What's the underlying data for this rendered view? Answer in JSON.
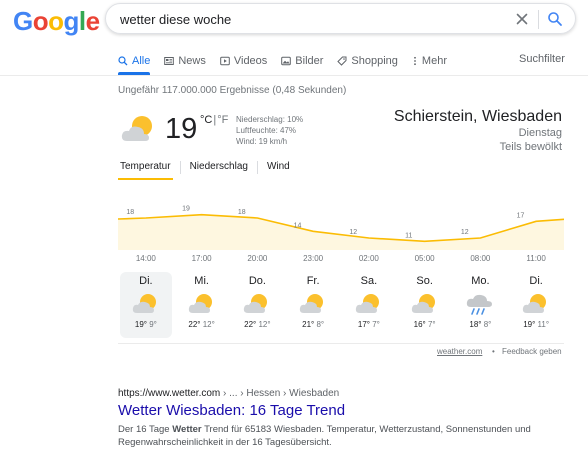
{
  "logo": {
    "letters": [
      "G",
      "o",
      "o",
      "g",
      "l",
      "e"
    ],
    "colors": [
      "#4285f4",
      "#ea4335",
      "#fbbc05",
      "#4285f4",
      "#34a853",
      "#ea4335"
    ]
  },
  "search": {
    "query": "wetter diese woche"
  },
  "tabs": [
    {
      "label": "Alle",
      "icon": "search-icon",
      "active": true
    },
    {
      "label": "News",
      "icon": "news-icon",
      "active": false
    },
    {
      "label": "Videos",
      "icon": "video-icon",
      "active": false
    },
    {
      "label": "Bilder",
      "icon": "image-icon",
      "active": false
    },
    {
      "label": "Shopping",
      "icon": "tag-icon",
      "active": false
    },
    {
      "label": "Mehr",
      "icon": "more-icon",
      "active": false
    }
  ],
  "suchfilter": "Suchfilter",
  "result_stats": "Ungefähr 117.000.000 Ergebnisse (0,48 Sekunden)",
  "weather": {
    "temperature": "19",
    "unit_c": "°C",
    "unit_sep": "|",
    "unit_f": "°F",
    "precipitation": "Niederschlag: 10%",
    "humidity": "Luftfeuchte: 47%",
    "wind": "Wind: 19 km/h",
    "location": "Schierstein, Wiesbaden",
    "day": "Dienstag",
    "condition": "Teils bewölkt",
    "tabs": [
      "Temperatur",
      "Niederschlag",
      "Wind"
    ],
    "times": [
      "14:00",
      "17:00",
      "20:00",
      "23:00",
      "02:00",
      "05:00",
      "08:00",
      "11:00"
    ],
    "forecast": [
      {
        "day": "Di.",
        "hi": "19°",
        "lo": "9°",
        "icon": "partly-cloudy-icon",
        "selected": true
      },
      {
        "day": "Mi.",
        "hi": "22°",
        "lo": "12°",
        "icon": "partly-cloudy-icon",
        "selected": false
      },
      {
        "day": "Do.",
        "hi": "22°",
        "lo": "12°",
        "icon": "partly-cloudy-icon",
        "selected": false
      },
      {
        "day": "Fr.",
        "hi": "21°",
        "lo": "8°",
        "icon": "partly-cloudy-icon",
        "selected": false
      },
      {
        "day": "Sa.",
        "hi": "17°",
        "lo": "7°",
        "icon": "partly-cloudy-icon",
        "selected": false
      },
      {
        "day": "So.",
        "hi": "16°",
        "lo": "7°",
        "icon": "partly-cloudy-icon",
        "selected": false
      },
      {
        "day": "Mo.",
        "hi": "18°",
        "lo": "8°",
        "icon": "rain-icon",
        "selected": false
      },
      {
        "day": "Di.",
        "hi": "19°",
        "lo": "11°",
        "icon": "partly-cloudy-icon",
        "selected": false
      }
    ],
    "source": "weather.com",
    "feedback": "Feedback geben",
    "dot": "•"
  },
  "chart_data": {
    "type": "area",
    "x": [
      "14:00",
      "17:00",
      "20:00",
      "23:00",
      "02:00",
      "05:00",
      "08:00",
      "11:00"
    ],
    "values": [
      18,
      19,
      18,
      14,
      12,
      11,
      12,
      17
    ],
    "label_values": [
      "18",
      "19",
      "18",
      "14",
      "12",
      "11",
      "12",
      "17"
    ],
    "colors": {
      "line": "#fbbc04",
      "fill": "#fef7e0"
    }
  },
  "result": {
    "url": "https://www.wetter.com",
    "breadcrumb": " › ... › Hessen › Wiesbaden",
    "title": "Wetter Wiesbaden: 16 Tage Trend",
    "snippet_1": "Der 16 Tage ",
    "snippet_bold": "Wetter",
    "snippet_2": " Trend für 65183 Wiesbaden. Temperatur, Wetterzustand, Sonnenstunden und Regenwahrscheinlichkeit in der 16 Tagesübersicht."
  }
}
